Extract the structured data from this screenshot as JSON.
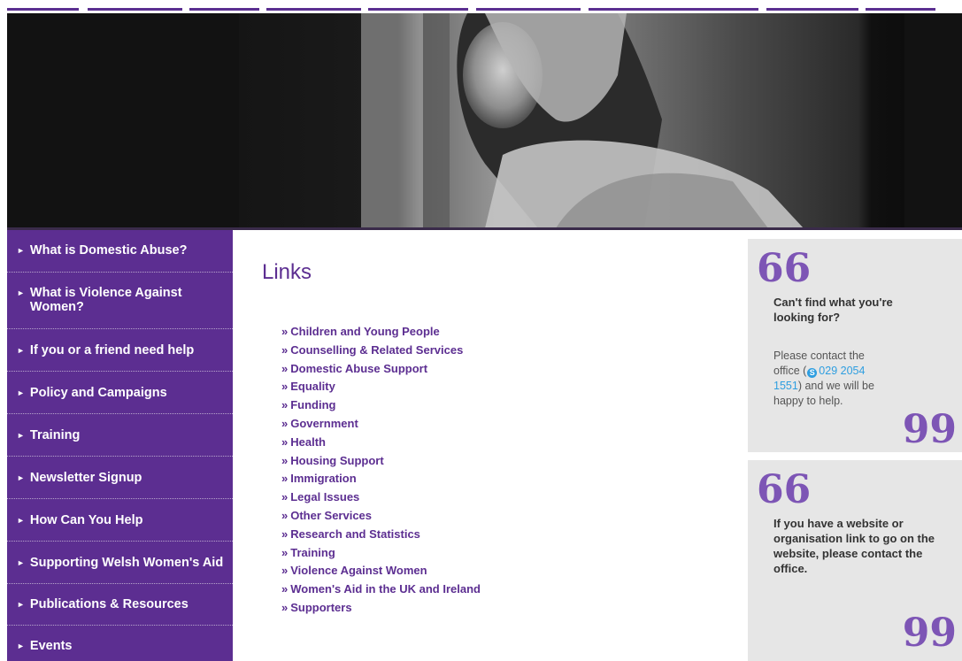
{
  "nav": {
    "color": "#5b2f91"
  },
  "sidebar": {
    "bg_color": "#5c2e91",
    "items": [
      {
        "label": "What is Domestic Abuse?"
      },
      {
        "label": "What is Violence Against Women?"
      },
      {
        "label": "If you or a friend need help"
      },
      {
        "label": "Policy and Campaigns"
      },
      {
        "label": "Training"
      },
      {
        "label": "Newsletter Signup"
      },
      {
        "label": "How Can You Help"
      },
      {
        "label": "Supporting Welsh Women's Aid"
      },
      {
        "label": "Publications & Resources"
      },
      {
        "label": "Events"
      }
    ]
  },
  "main": {
    "title": "Links",
    "links": [
      "Children and Young People",
      "Counselling & Related Services",
      "Domestic Abuse Support",
      "Equality",
      "Funding",
      "Government",
      "Health",
      "Housing Support",
      "Immigration",
      "Legal Issues",
      "Other Services",
      "Research and Statistics",
      "Training",
      "Violence Against Women",
      "Women's Aid in the UK and Ireland",
      "Supporters"
    ],
    "link_prefix": "»"
  },
  "quotes": [
    {
      "heading": "Can't find what you're looking for?",
      "body_before": "Please contact the office (",
      "phone": "029 2054 1551",
      "body_after": ") and we will be happy to help."
    },
    {
      "heading": "If you have a website or organisation link to go on the website, please contact the office."
    }
  ],
  "quote_marks": {
    "open": "66",
    "close": "99"
  },
  "colors": {
    "accent": "#5c2e91",
    "quote_mark": "#7d55b5",
    "phone_link": "#2e9ee0",
    "quote_bg": "#e6e6e6"
  }
}
